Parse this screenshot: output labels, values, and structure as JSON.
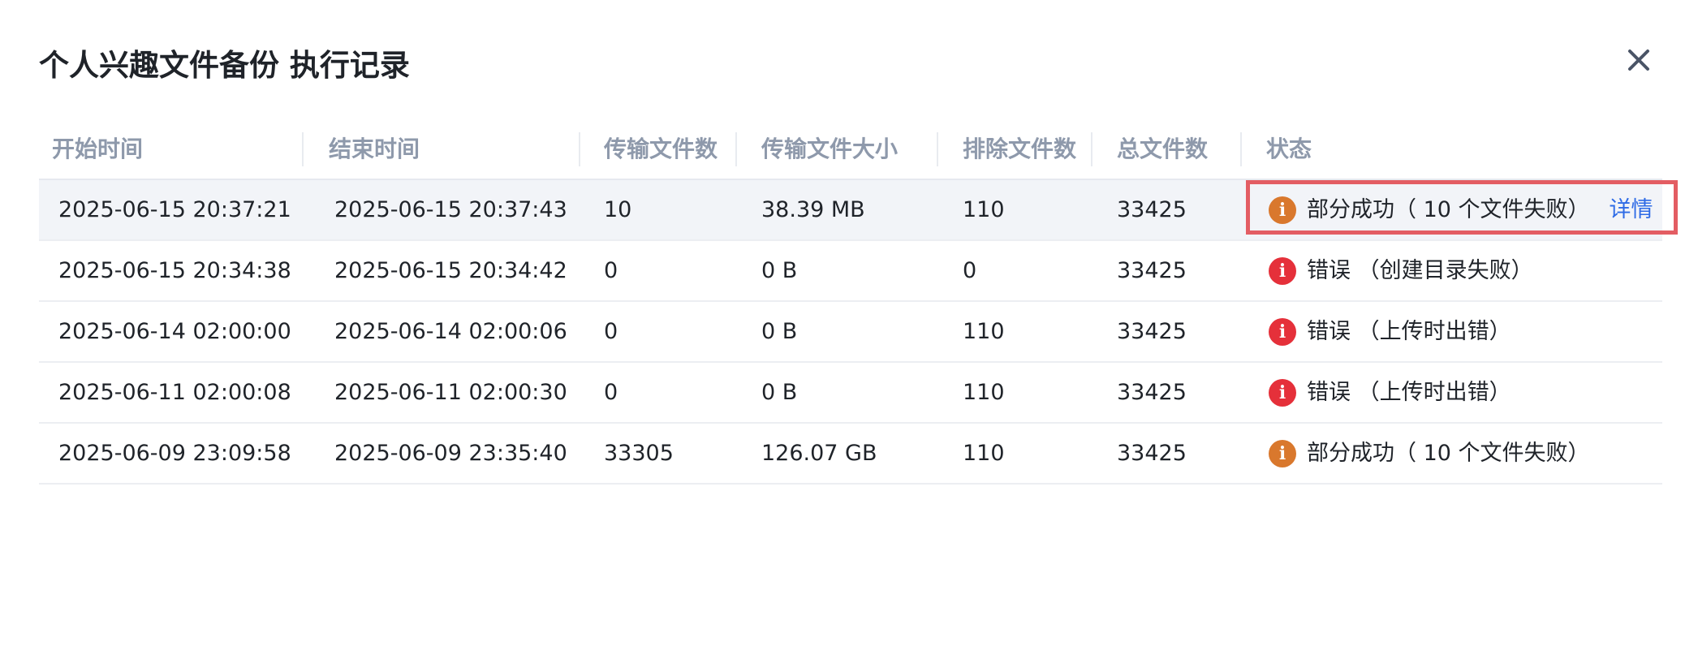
{
  "dialog": {
    "title": "个人兴趣文件备份 执行记录",
    "close_icon": "close-icon"
  },
  "colors": {
    "warning": "#d9782d",
    "error": "#e5303a",
    "link": "#2e6be6",
    "annotation": "#e35d63"
  },
  "table": {
    "columns": [
      "开始时间",
      "结束时间",
      "传输文件数",
      "传输文件大小",
      "排除文件数",
      "总文件数",
      "状态"
    ],
    "rows": [
      {
        "start": "2025-06-15 20:37:21",
        "end": "2025-06-15 20:37:43",
        "transferred": "10",
        "size": "38.39 MB",
        "excluded": "110",
        "total": "33425",
        "status_type": "warning",
        "status_icon": "info-icon",
        "status_text": "部分成功（ 10 个文件失败）",
        "detail": "详情"
      },
      {
        "start": "2025-06-15 20:34:38",
        "end": "2025-06-15 20:34:42",
        "transferred": "0",
        "size": "0 B",
        "excluded": "0",
        "total": "33425",
        "status_type": "error",
        "status_icon": "error-icon",
        "status_text": "错误 （创建目录失败）"
      },
      {
        "start": "2025-06-14 02:00:00",
        "end": "2025-06-14 02:00:06",
        "transferred": "0",
        "size": "0 B",
        "excluded": "110",
        "total": "33425",
        "status_type": "error",
        "status_icon": "error-icon",
        "status_text": "错误 （上传时出错）"
      },
      {
        "start": "2025-06-11 02:00:08",
        "end": "2025-06-11 02:00:30",
        "transferred": "0",
        "size": "0 B",
        "excluded": "110",
        "total": "33425",
        "status_type": "error",
        "status_icon": "error-icon",
        "status_text": "错误 （上传时出错）"
      },
      {
        "start": "2025-06-09 23:09:58",
        "end": "2025-06-09 23:35:40",
        "transferred": "33305",
        "size": "126.07 GB",
        "excluded": "110",
        "total": "33425",
        "status_type": "warning",
        "status_icon": "info-icon",
        "status_text": "部分成功（ 10 个文件失败）"
      }
    ]
  }
}
